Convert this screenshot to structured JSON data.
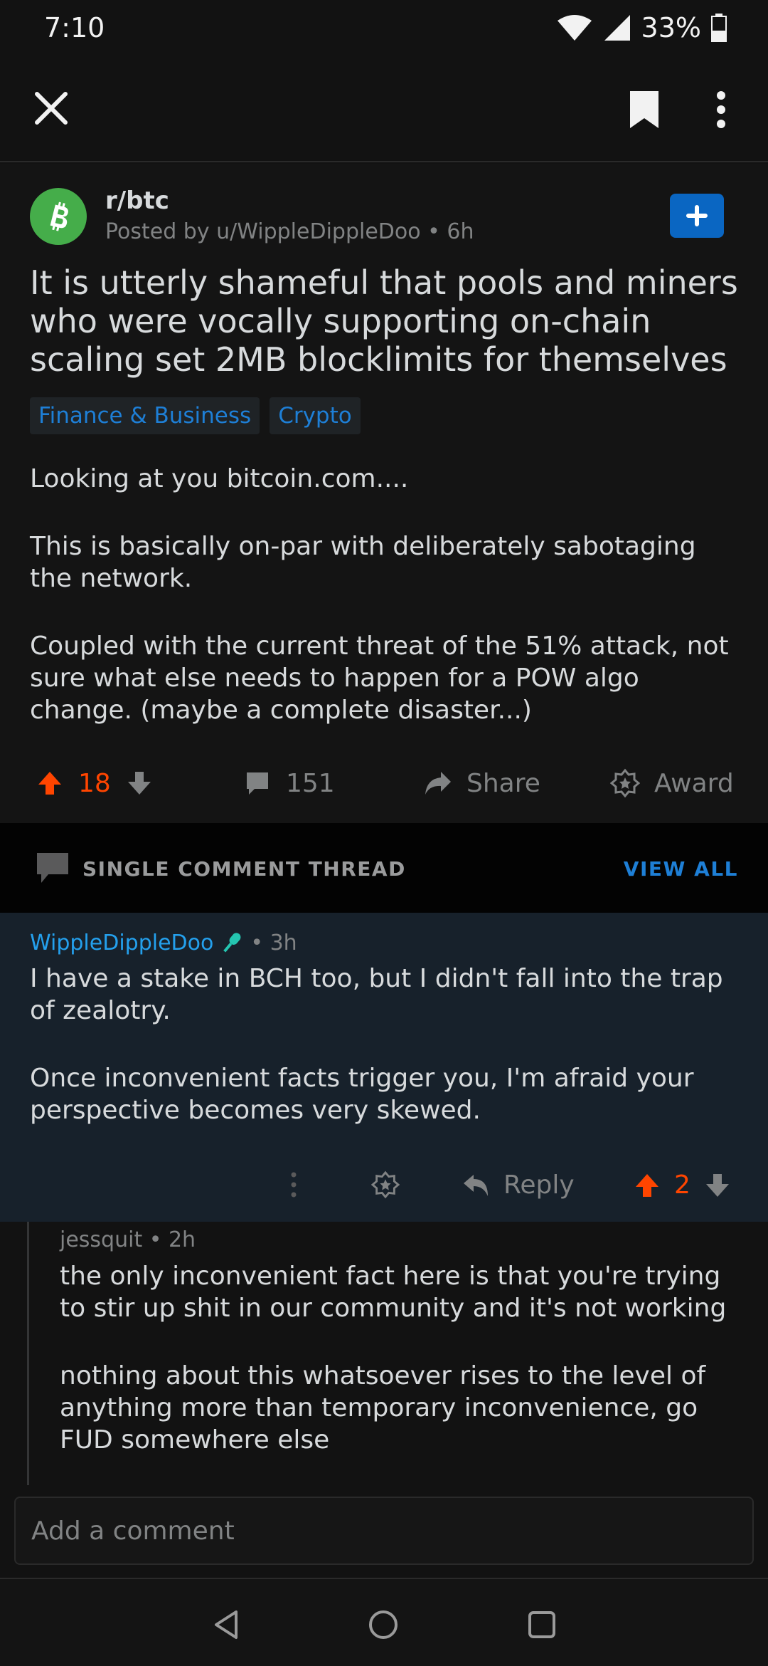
{
  "status_bar": {
    "time": "7:10",
    "battery": "33%"
  },
  "toolbar": {
    "close_icon": "close-icon",
    "bookmark_icon": "bookmark-icon",
    "more_icon": "more-vertical-icon"
  },
  "post": {
    "subreddit": "r/btc",
    "posted_by": "Posted by u/WippleDippleDoo • 6h",
    "title": "It is utterly shameful that pools and miners who were vocally supporting on-chain scaling set 2MB blocklimits for themselves",
    "flairs": [
      "Finance & Business",
      "Crypto"
    ],
    "body": [
      "Looking at you bitcoin.com....",
      "This is basically on-par with deliberately sabotaging the network.",
      "Coupled with the current threat of the 51% attack, not sure what else needs to happen for a POW algo change. (maybe a complete disaster...)"
    ],
    "votes": "18",
    "comments": "151",
    "share_label": "Share",
    "award_label": "Award"
  },
  "thread_bar": {
    "label": "SINGLE COMMENT THREAD",
    "view_all": "VIEW ALL"
  },
  "comments": [
    {
      "author": "WippleDippleDoo",
      "time": "• 3h",
      "body": [
        "I have a stake in BCH too, but I didn't fall into the trap of zealotry.",
        "Once inconvenient facts trigger you, I'm afraid your perspective becomes very skewed."
      ],
      "reply_label": "Reply",
      "votes": "2"
    },
    {
      "meta": "jessquit • 2h",
      "body": [
        "the only inconvenient fact here is that you're trying to stir up shit in our community and it's not working",
        "nothing about this whatsoever rises to the level of anything more than temporary inconvenience, go FUD somewhere else"
      ]
    }
  ],
  "add_comment": {
    "placeholder": "Add a comment"
  },
  "colors": {
    "accent_orange": "#ff4500",
    "link_blue": "#1e7fd6",
    "subreddit_green": "#45ad4a"
  }
}
